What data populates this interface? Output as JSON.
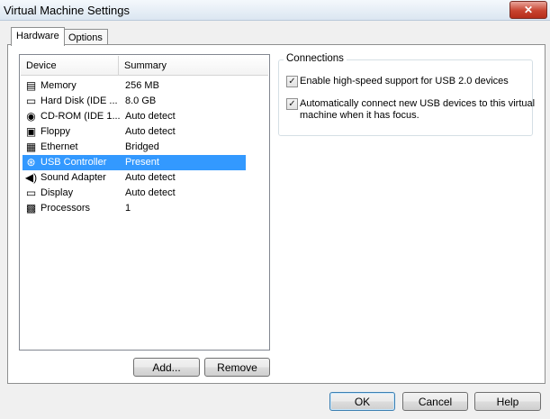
{
  "window": {
    "title": "Virtual Machine Settings",
    "close_glyph": "✕"
  },
  "tabs": [
    {
      "label": "Hardware"
    },
    {
      "label": "Options"
    }
  ],
  "device_list": {
    "headers": {
      "device": "Device",
      "summary": "Summary"
    },
    "rows": [
      {
        "name": "Memory",
        "summary": "256 MB",
        "icon": "memory-icon",
        "glyph": "▤"
      },
      {
        "name": "Hard Disk (IDE ...",
        "summary": "8.0 GB",
        "icon": "hard-disk-icon",
        "glyph": "▭"
      },
      {
        "name": "CD-ROM (IDE 1...",
        "summary": "Auto detect",
        "icon": "cdrom-icon",
        "glyph": "◉"
      },
      {
        "name": "Floppy",
        "summary": "Auto detect",
        "icon": "floppy-icon",
        "glyph": "▣"
      },
      {
        "name": "Ethernet",
        "summary": "Bridged",
        "icon": "ethernet-icon",
        "glyph": "▦"
      },
      {
        "name": "USB Controller",
        "summary": "Present",
        "icon": "usb-icon",
        "glyph": "⊛"
      },
      {
        "name": "Sound Adapter",
        "summary": "Auto detect",
        "icon": "speaker-icon",
        "glyph": "◀)"
      },
      {
        "name": "Display",
        "summary": "Auto detect",
        "icon": "monitor-icon",
        "glyph": "▭"
      },
      {
        "name": "Processors",
        "summary": "1",
        "icon": "processor-icon",
        "glyph": "▩"
      }
    ],
    "selected": "USB Controller"
  },
  "buttons": {
    "add": "Add...",
    "remove": "Remove",
    "ok": "OK",
    "cancel": "Cancel",
    "help": "Help"
  },
  "connections": {
    "title": "Connections",
    "enable_usb2": {
      "checked": true,
      "label": "Enable high-speed support for USB 2.0 devices"
    },
    "auto_connect": {
      "checked": true,
      "label_line1": "Automatically connect new USB devices to this virtual",
      "label_line2": "machine when it has focus."
    }
  },
  "colors": {
    "selection": "#3399ff",
    "window_bg": "#f0f0f0",
    "close_button": "#c8432f"
  }
}
